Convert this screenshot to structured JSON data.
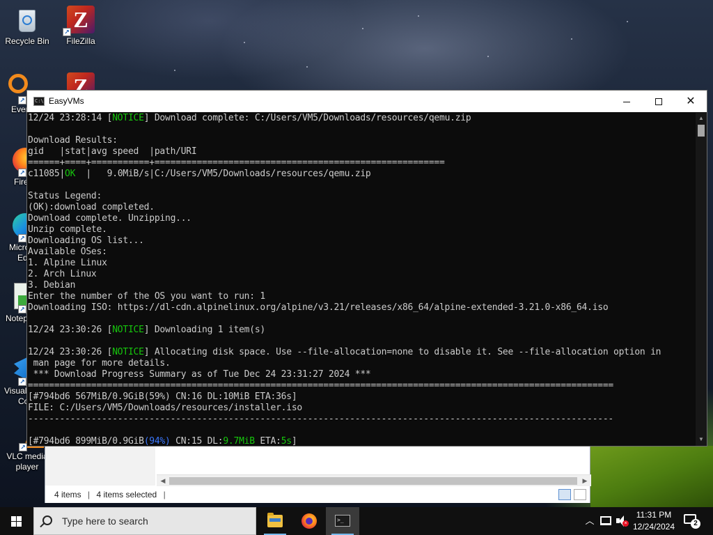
{
  "desktop": {
    "icons": [
      {
        "label": "Recycle Bin",
        "icon": "recycle-bin-icon"
      },
      {
        "label": "FileZilla",
        "icon": "filezilla-icon"
      },
      {
        "label": "Every",
        "icon": "everything-search-icon"
      },
      {
        "label": "Fire",
        "icon": "firefox-icon"
      },
      {
        "label": "Micro",
        "icon": "edge-icon"
      },
      {
        "label": "Ed",
        "icon": "edge-icon"
      },
      {
        "label": "Notep",
        "icon": "notepad-icon"
      },
      {
        "label": "Visual",
        "icon": "vscode-icon"
      },
      {
        "label": "Co",
        "icon": "vscode-icon"
      },
      {
        "label": "VLC media",
        "icon": "vlc-icon"
      },
      {
        "label": "player",
        "icon": "vlc-icon"
      }
    ]
  },
  "explorer": {
    "status_items": "4 items",
    "status_selected": "4 items selected",
    "separator": "|"
  },
  "console": {
    "title": "EasyVMs",
    "lines": [
      [
        "12/24 23:28:14 [",
        "NOTICE",
        "] Download complete: C:/Users/VM5/Downloads/resources/qemu.zip"
      ],
      "",
      "Download Results:",
      "gid   |stat|avg speed  |path/URI",
      "======+====+===========+=======================================================",
      [
        "c11085|",
        "OK",
        "  |   9.0MiB/s|C:/Users/VM5/Downloads/resources/qemu.zip"
      ],
      "",
      "Status Legend:",
      "(OK):download completed.",
      "Download complete. Unzipping...",
      "Unzip complete.",
      "Downloading OS list...",
      "Available OSes:",
      "1. Alpine Linux",
      "2. Arch Linux",
      "3. Debian",
      "Enter the number of the OS you want to run: 1",
      "Downloading ISO: https://dl-cdn.alpinelinux.org/alpine/v3.21/releases/x86_64/alpine-extended-3.21.0-x86_64.iso",
      "",
      [
        "12/24 23:30:26 [",
        "NOTICE",
        "] Downloading 1 item(s)"
      ],
      "",
      [
        "12/24 23:30:26 [",
        "NOTICE",
        "] Allocating disk space. Use --file-allocation=none to disable it. See --file-allocation option in"
      ],
      " man page for more details.",
      " *** Download Progress Summary as of Tue Dec 24 23:31:27 2024 ***",
      "===============================================================================================================",
      "[#794bd6 567MiB/0.9GiB(59%) CN:16 DL:10MiB ETA:36s]",
      "FILE: C:/Users/VM5/Downloads/resources/installer.iso",
      "---------------------------------------------------------------------------------------------------------------",
      "",
      {
        "progress": [
          "[#794bd6 899MiB/0.9GiB",
          "(94%)",
          " CN:15 DL:",
          "9.7MiB",
          " ETA:",
          "5s",
          "]"
        ]
      }
    ]
  },
  "taskbar": {
    "search_placeholder": "Type here to search",
    "time": "11:31 PM",
    "date": "12/24/2024",
    "notification_count": "2"
  },
  "colors": {
    "notice_green": "#16c60c",
    "percent_blue": "#3b78ff",
    "taskbar_bg": "#101010",
    "console_bg": "#0c0c0c"
  }
}
